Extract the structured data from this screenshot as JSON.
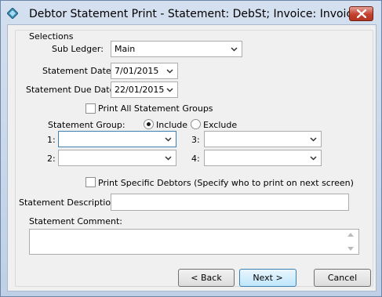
{
  "window": {
    "title": "Debtor Statement Print  - Statement: DebSt;  Invoice: Invoice"
  },
  "form": {
    "group_label": "Selections",
    "sub_ledger": {
      "label": "Sub Ledger:",
      "value": "Main"
    },
    "statement_date": {
      "label": "Statement Date:",
      "value": "7/01/2015"
    },
    "statement_due_date": {
      "label": "Statement Due Date:",
      "value": "22/01/2015"
    },
    "print_all_groups": {
      "label": "Print All Statement Groups",
      "checked": false
    },
    "statement_group": {
      "label": "Statement Group:",
      "include_label": "Include",
      "exclude_label": "Exclude",
      "selected": "Include",
      "slots": [
        {
          "label": "1:",
          "value": ""
        },
        {
          "label": "2:",
          "value": ""
        },
        {
          "label": "3:",
          "value": ""
        },
        {
          "label": "4:",
          "value": ""
        }
      ]
    },
    "print_specific_debtors": {
      "label": "Print Specific Debtors  (Specify who to print on next screen)",
      "checked": false
    },
    "statement_description": {
      "label": "Statement Description:",
      "value": ""
    },
    "statement_comment": {
      "label": "Statement Comment:",
      "value": ""
    }
  },
  "buttons": {
    "back": "< Back",
    "next": "Next >",
    "cancel": "Cancel"
  }
}
